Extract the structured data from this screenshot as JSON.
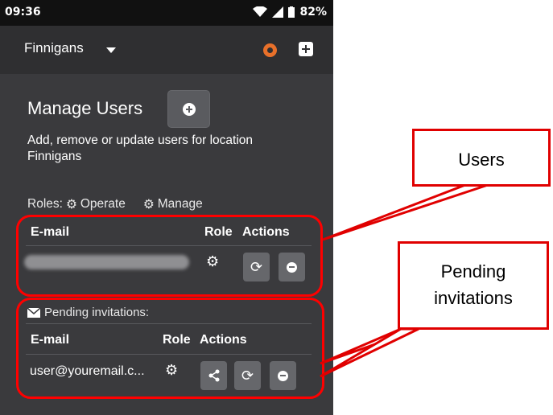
{
  "status_bar": {
    "time": "09:36",
    "battery": "82%"
  },
  "app_bar": {
    "location": "Finnigans",
    "logo_icon": "orange-logo-icon",
    "add_icon": "plus-square-icon"
  },
  "manage": {
    "title": "Manage Users",
    "subtitle": "Add, remove or update users for location Finnigans",
    "roles_label": "Roles:",
    "role_operate": "Operate",
    "role_manage": "Manage"
  },
  "users_table": {
    "col_email": "E-mail",
    "col_role": "Role",
    "col_actions": "Actions",
    "rows": [
      {
        "email": "",
        "role_icon": "gear-icon"
      }
    ]
  },
  "pending": {
    "label": "Pending invitations:",
    "col_email": "E-mail",
    "col_role": "Role",
    "col_actions": "Actions",
    "rows": [
      {
        "email": "user@youremail.c...",
        "role_icon": "gear-icon"
      }
    ]
  },
  "callouts": {
    "users": "Users",
    "pending": "Pending invitations"
  },
  "colors": {
    "annotation_red": "#ff0000",
    "app_bg": "#3a3a3d",
    "button_bg": "#66676b"
  }
}
